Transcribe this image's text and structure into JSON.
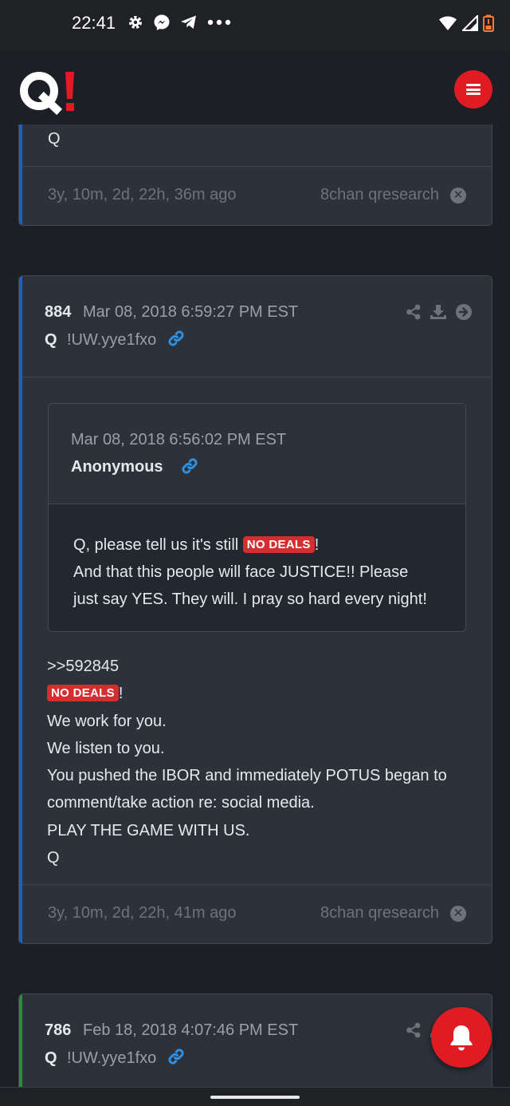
{
  "status_bar": {
    "time": "22:41",
    "left_icons": [
      "gear-icon",
      "messenger-icon",
      "telegram-icon",
      "more-dots-icon"
    ],
    "right_icons": [
      "wifi-icon",
      "signal-icon",
      "battery-icon"
    ]
  },
  "app": {
    "logo_text": "Q!",
    "menu_icon": "hamburger-menu-icon",
    "accent": "#e01b24"
  },
  "posts": [
    {
      "partial": true,
      "body_tail": "Q",
      "age": "3y, 10m, 2d, 22h, 36m ago",
      "source": "8chan qresearch",
      "accent": "#1f5fbf"
    },
    {
      "number": "884",
      "date": "Mar 08, 2018 6:59:27 PM EST",
      "author": "Q",
      "tripcode": "!UW.yye1fxo",
      "accent": "#1f5fbf",
      "quoted": {
        "date": "Mar 08, 2018 6:56:02 PM EST",
        "author": "Anonymous",
        "line1_pre": "Q, please tell us it's still",
        "tag": "NO DEALS",
        "line1_post": "!",
        "line2": "And that this people will face JUSTICE!! Please",
        "line3": "just say YES. They will. I pray so hard every night!"
      },
      "reply_ref": ">>592845",
      "tag": "NO DEALS",
      "tag_post": "!",
      "lines": [
        "We work for you.",
        "We listen to you.",
        "You pushed the IBOR and immediately POTUS began to",
        "comment/take action re: social media.",
        "PLAY THE GAME WITH US.",
        "Q"
      ],
      "age": "3y, 10m, 2d, 22h, 41m ago",
      "source": "8chan qresearch"
    },
    {
      "number": "786",
      "date": "Feb 18, 2018 4:07:46 PM EST",
      "author": "Q",
      "tripcode": "!UW.yye1fxo",
      "accent": "#2e8b3e"
    }
  ],
  "fab": {
    "icon": "bell-icon"
  }
}
